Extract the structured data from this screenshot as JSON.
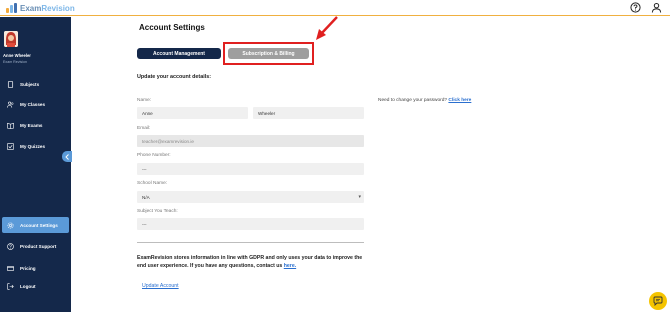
{
  "app": {
    "logo_prefix": "Exam",
    "logo_suffix": "Revision"
  },
  "user": {
    "name": "Anne Wheeler",
    "role": "Exam Revision"
  },
  "sidebar": {
    "items": [
      {
        "label": "Subjects",
        "icon": "tablet-icon"
      },
      {
        "label": "My Classes",
        "icon": "people-icon"
      },
      {
        "label": "My Exams",
        "icon": "book-icon"
      },
      {
        "label": "My Quizzes",
        "icon": "checkbox-icon"
      },
      {
        "label": "Account Settings",
        "icon": "gear-icon"
      },
      {
        "label": "Product Support",
        "icon": "help-icon"
      },
      {
        "label": "Pricing",
        "icon": "card-icon"
      },
      {
        "label": "Logout",
        "icon": "logout-icon"
      }
    ],
    "active_item": "Account Settings"
  },
  "page": {
    "title": "Account Settings",
    "tabs": {
      "account": "Account Management",
      "subscription": "Subscription & Billing"
    },
    "subhead": "Update your account details:",
    "labels": {
      "name": "Name:",
      "email": "Email:",
      "phone": "Phone Number:",
      "school": "School Name:",
      "subject": "Subject You Teach:"
    },
    "values": {
      "first_name": "Anne",
      "last_name": "Wheeler",
      "email": "teacher@examrevision.ie",
      "phone": "---",
      "school": "N/A",
      "subject": "---"
    },
    "gdpr_text": "ExamRevision stores information in line with GDPR and only uses your data to improve the end user experience. If you have any questions, contact us ",
    "gdpr_link": "here.",
    "update_link": "Update Account",
    "password_text": "Need to change your password? ",
    "password_link": "Click here"
  },
  "colors": {
    "sidebar_bg": "#14284a",
    "active_item": "#5b9ad8",
    "highlight": "#e02020",
    "chat": "#f5c400"
  }
}
